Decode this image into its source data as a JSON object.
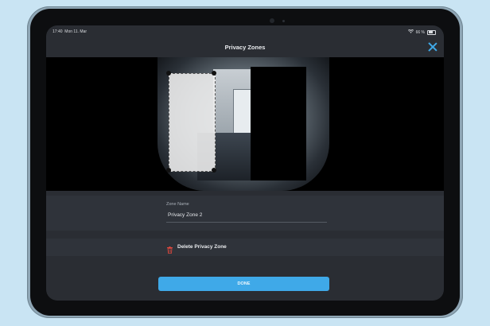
{
  "status_bar": {
    "time": "17:40",
    "date": "Mon 11. Mar",
    "wifi_icon": "wifi-icon",
    "battery_text": "66 %",
    "battery_level": 0.66
  },
  "nav": {
    "title": "Privacy Zones",
    "close_icon": "close-icon"
  },
  "zone_field": {
    "label": "Zone Name",
    "value": "Privacy Zone 2"
  },
  "actions": {
    "delete_label": "Delete Privacy Zone",
    "delete_icon": "trash-icon",
    "done_label": "DONE"
  },
  "colors": {
    "accent": "#3fa9e8",
    "danger": "#e0483e",
    "background": "#2a2d33"
  }
}
